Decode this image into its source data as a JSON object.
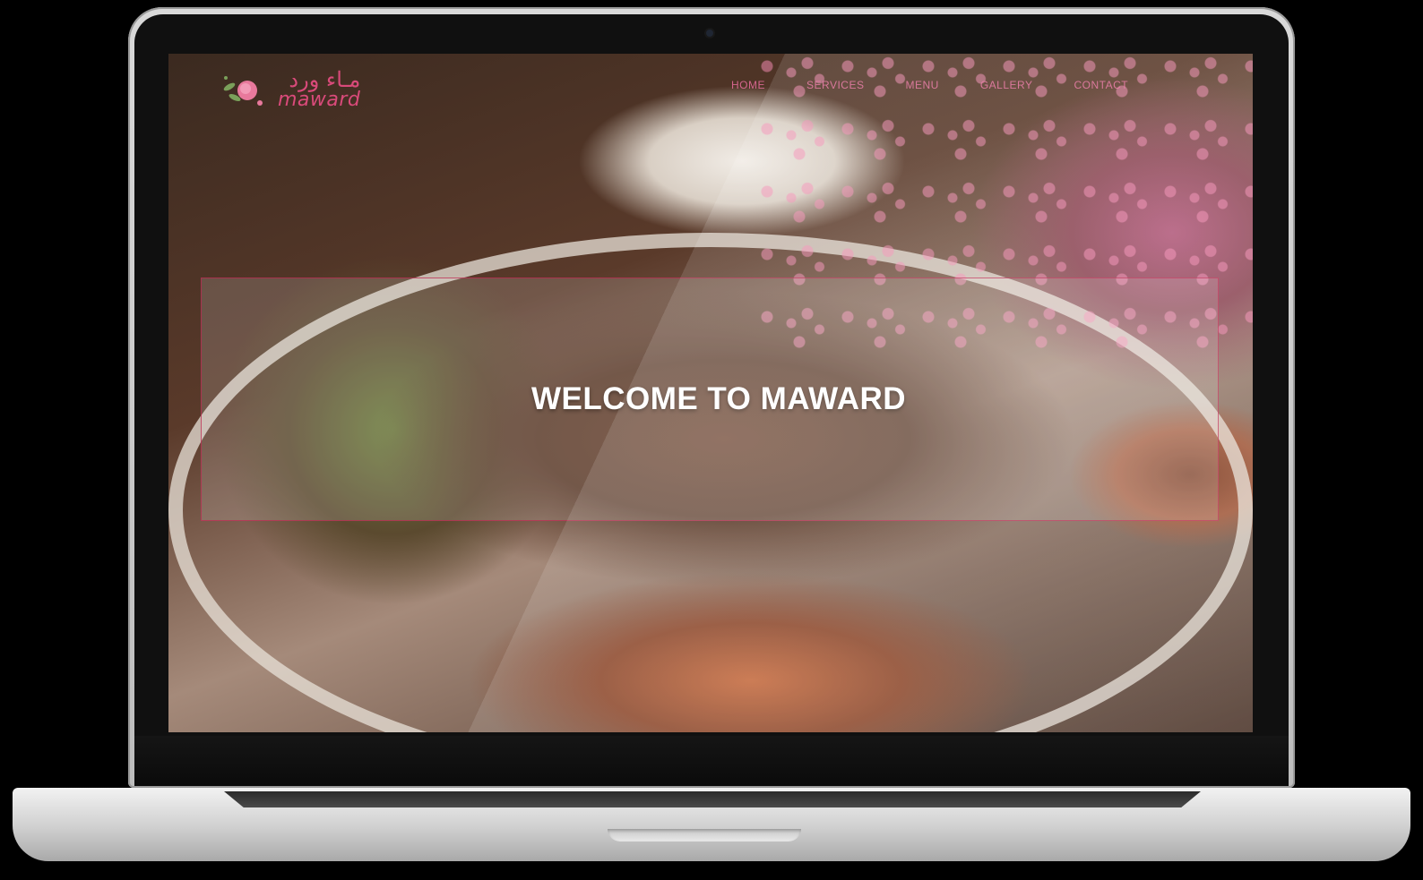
{
  "site": {
    "logo": {
      "arabic": "مـاء ورد",
      "latin": "maward",
      "icon": "rose-icon",
      "color": "#d94a7a"
    },
    "nav": {
      "items": [
        {
          "label": "Home"
        },
        {
          "label": "Services"
        },
        {
          "label": "Menu"
        },
        {
          "label": "Gallery"
        },
        {
          "label": "Contact"
        }
      ],
      "color": "#eb6ea0"
    },
    "hero": {
      "title": "WELCOME TO MAWARD",
      "border_color": "#be2850"
    }
  }
}
